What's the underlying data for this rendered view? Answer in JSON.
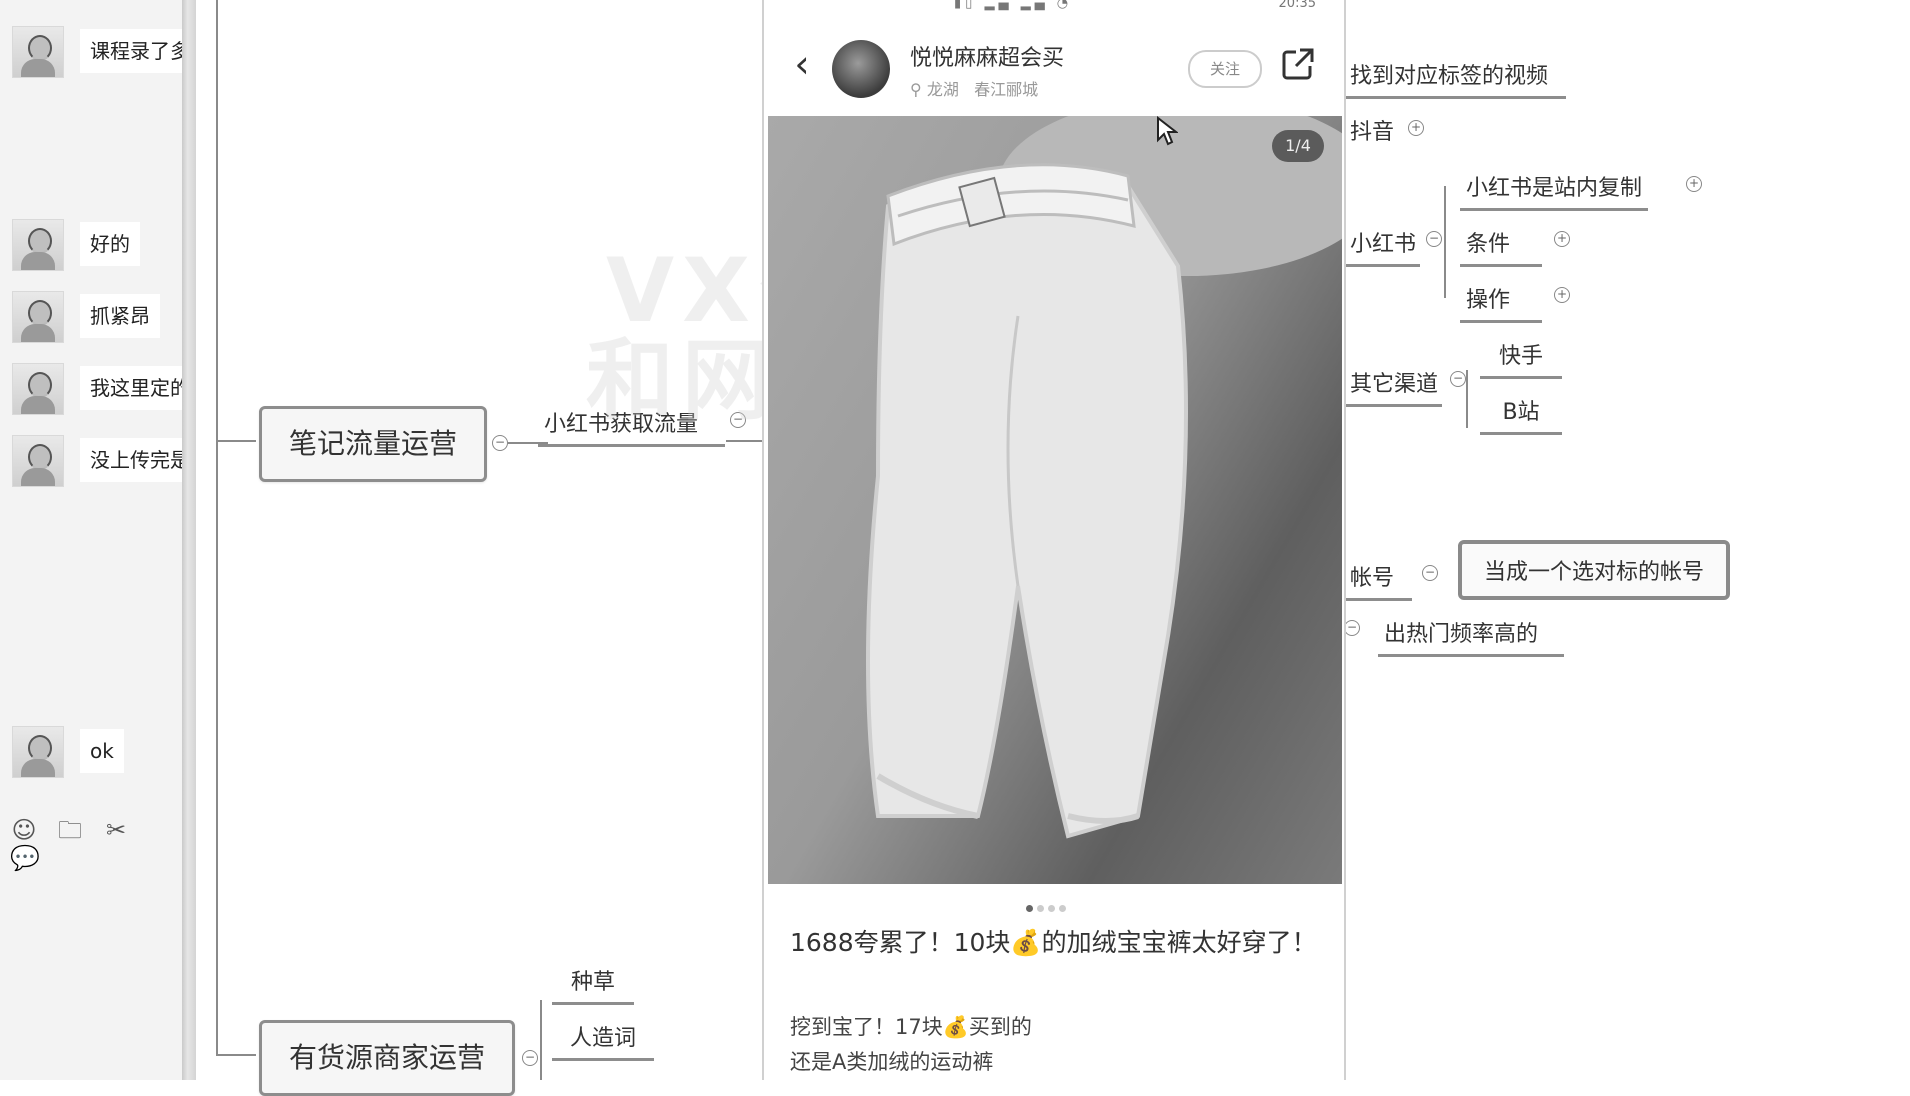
{
  "chat": {
    "messages": [
      {
        "text": "课程录了多"
      },
      {
        "text": "好的"
      },
      {
        "text": "抓紧昂"
      },
      {
        "text": "我这里定的"
      },
      {
        "text": "没上传完是"
      },
      {
        "text": "ok"
      }
    ],
    "tools": [
      "emoji-icon",
      "folder-icon",
      "scissors-icon",
      "chat-bubble-icon"
    ]
  },
  "mindmap": {
    "main_topics": [
      "笔记流量运营",
      "有货源商家运营"
    ],
    "branch_xhs": "小红书获取流量",
    "branch_right": {
      "find_video": "找到对应标签的视频",
      "douyin": "抖音",
      "xiaohongshu": "小红书",
      "xhs_copy": "小红书是站内复制",
      "conditions": "条件",
      "operation": "操作",
      "other_channels": "其它渠道",
      "kuaishou": "快手",
      "bilibili": "B站",
      "account": "帐号",
      "benchmark_account": "当成一个选对标的帐号",
      "hot_freq": "出热门频率高的"
    },
    "branch_goods": [
      "种草",
      "人造词"
    ]
  },
  "watermark": [
    "VX公众号",
    "和网讲运营"
  ],
  "post": {
    "status_right": "20:35",
    "author_name": "悦悦麻麻超会买",
    "location_a": "龙湖",
    "location_b": "春江郦城",
    "follow_label": "关注",
    "photo_counter": "1/4",
    "title": "1688夸累了！10块💰的加绒宝宝裤太好穿了！",
    "body_line1": "挖到宝了！17块💰买到的",
    "body_line2": "还是A类加绒的运动裤"
  },
  "colors": {
    "node_border": "#8d8d8d",
    "chat_bg": "#f3f3f3"
  }
}
